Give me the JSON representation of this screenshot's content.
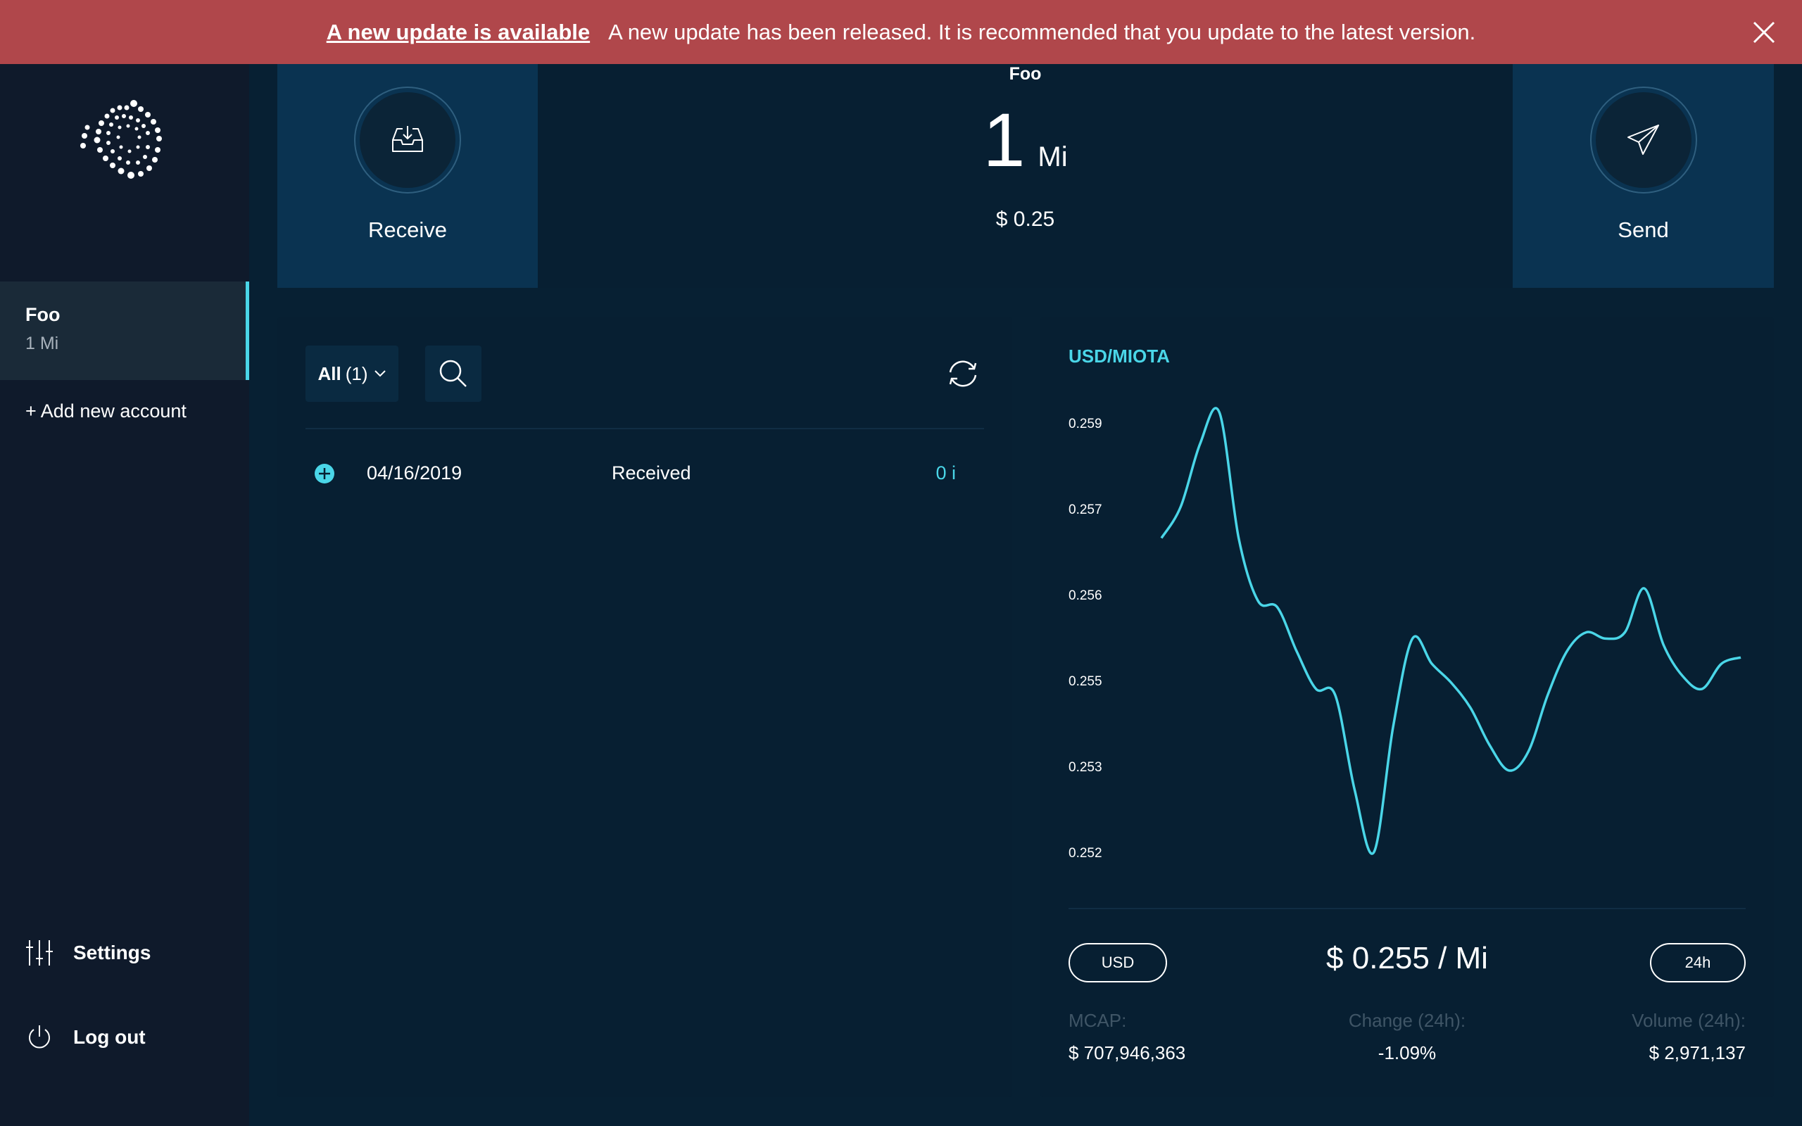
{
  "banner": {
    "title": "A new update is available",
    "message": "A new update has been released. It is recommended that you update to the latest version."
  },
  "sidebar": {
    "accounts": [
      {
        "name": "Foo",
        "balance": "1 Mi"
      }
    ],
    "add_account": "+ Add new account",
    "settings": "Settings",
    "logout": "Log out"
  },
  "balance": {
    "account_name": "Foo",
    "amount": "1",
    "unit": "Mi",
    "fiat": "$ 0.25",
    "receive_label": "Receive",
    "send_label": "Send"
  },
  "transactions": {
    "filter_label": "All",
    "filter_count": "(1)",
    "rows": [
      {
        "date": "04/16/2019",
        "status": "Received",
        "value": "0 i"
      }
    ]
  },
  "colors": {
    "accent": "#4ad6e8",
    "banner": "#b0474b",
    "sidebar_bg": "#0f1a2b",
    "panel_bg": "#071f32",
    "action_bg": "#0a3351"
  },
  "market": {
    "pair": "USD/MIOTA",
    "currency_btn": "USD",
    "timeframe_btn": "24h",
    "price": "$ 0.255 / Mi",
    "mcap_label": "MCAP:",
    "mcap_value": "$ 707,946,363",
    "change_label": "Change (24h):",
    "change_value": "-1.09%",
    "volume_label": "Volume (24h):",
    "volume_value": "$ 2,971,137"
  },
  "chart_data": {
    "type": "line",
    "title": "USD/MIOTA",
    "y_ticks": [
      "0.259",
      "0.257",
      "0.256",
      "0.255",
      "0.253",
      "0.252"
    ],
    "grid": false,
    "series": [
      {
        "values": [
          0.257,
          0.2575,
          0.2585,
          0.259,
          0.257,
          0.256,
          0.2559,
          0.2552,
          0.2546,
          0.2545,
          0.253,
          0.252,
          0.254,
          0.2554,
          0.255,
          0.2547,
          0.2543,
          0.2537,
          0.2533,
          0.2536,
          0.2545,
          0.2552,
          0.2555,
          0.2554,
          0.2555,
          0.2562,
          0.2553,
          0.2548,
          0.2546,
          0.255,
          0.2551
        ]
      }
    ]
  }
}
